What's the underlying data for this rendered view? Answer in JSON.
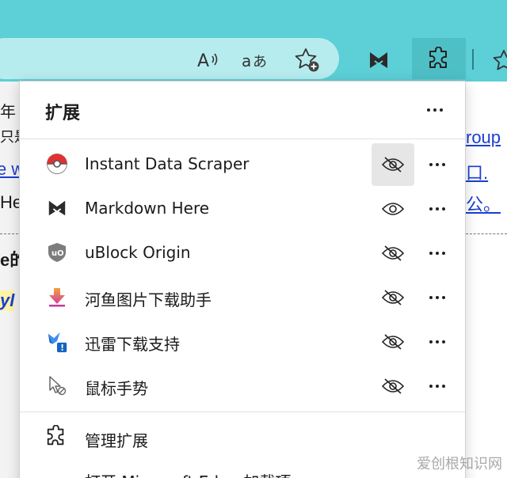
{
  "toolbar": {
    "read_aloud_icon": "read-aloud-icon",
    "translate_icon": "translate-icon",
    "favorites_icon": "add-favorite-icon",
    "markdown_icon": "markdown-here-icon",
    "extensions_icon": "puzzle-icon",
    "favorites_bar_icon": "star-icon"
  },
  "background": {
    "fragments": [
      "年",
      "只是",
      "e w",
      "He",
      "e的",
      "yl",
      "roup",
      "口.",
      "公。"
    ]
  },
  "panel": {
    "title": "扩展",
    "extensions": [
      {
        "name": "Instant Data Scraper",
        "icon": "pokeball-icon",
        "visible": false,
        "hovered": true
      },
      {
        "name": "Markdown Here",
        "icon": "markdown-here-icon",
        "visible": true,
        "hovered": false
      },
      {
        "name": "uBlock Origin",
        "icon": "ublock-shield-icon",
        "visible": false,
        "hovered": false
      },
      {
        "name": "河鱼图片下载助手",
        "icon": "download-arrow-icon",
        "visible": false,
        "hovered": false
      },
      {
        "name": "迅雷下载支持",
        "icon": "thunder-bird-icon",
        "visible": false,
        "hovered": false
      },
      {
        "name": "鼠标手势",
        "icon": "mouse-gesture-icon",
        "visible": false,
        "hovered": false
      }
    ],
    "manage_label": "管理扩展",
    "open_addons_label": "打开 Microsoft Edge 加载项"
  },
  "watermark": "爱创根知识网",
  "colors": {
    "toolbar": "#5dcfd6",
    "addressbar": "#b7ecef",
    "link": "#1a3fd1"
  }
}
